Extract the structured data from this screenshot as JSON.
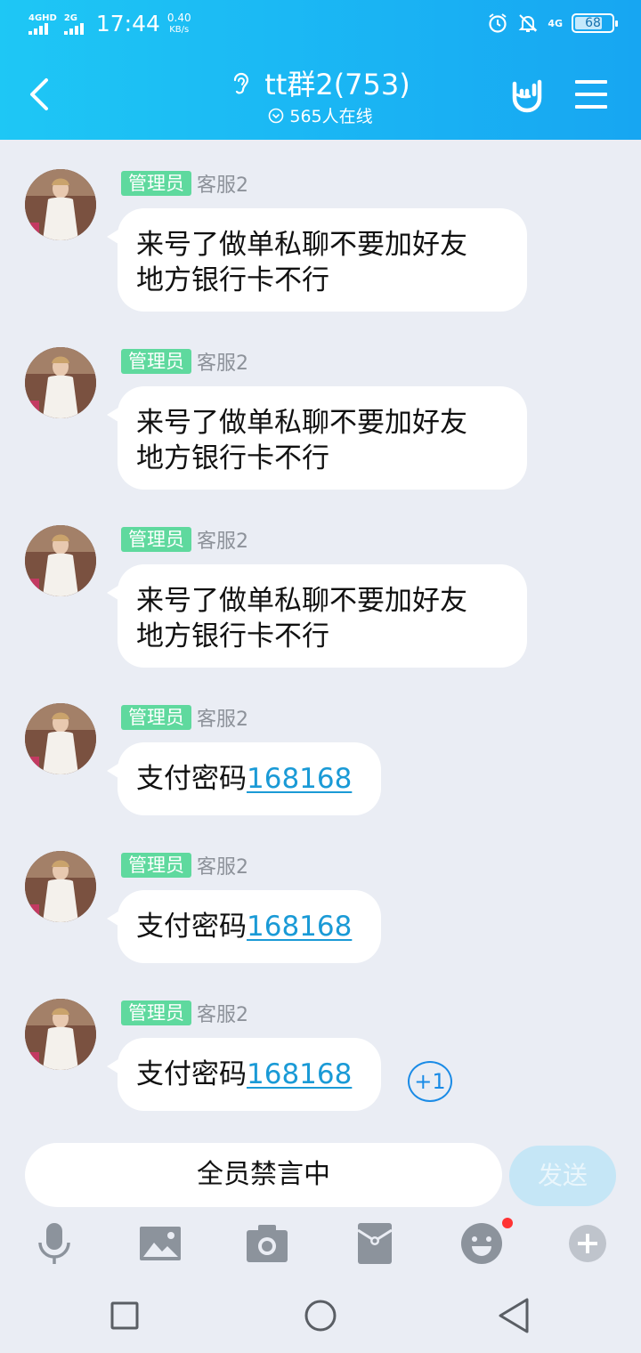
{
  "status_bar": {
    "sim1": "4GHD",
    "sim2": "2G",
    "time": "17:44",
    "speed_value": "0.40",
    "speed_unit": "KB/s",
    "net_small": "4G",
    "battery": "68"
  },
  "header": {
    "title": "tt群2(753)",
    "online": "565人在线"
  },
  "messages": [
    {
      "badge": "管理员",
      "sender": "客服2",
      "line1": "来号了做单私聊不要加好友",
      "line2": "地方银行卡不行"
    },
    {
      "badge": "管理员",
      "sender": "客服2",
      "line1": "来号了做单私聊不要加好友",
      "line2": "地方银行卡不行"
    },
    {
      "badge": "管理员",
      "sender": "客服2",
      "line1": "来号了做单私聊不要加好友",
      "line2": "地方银行卡不行"
    },
    {
      "badge": "管理员",
      "sender": "客服2",
      "text": "支付密码",
      "number": "168168"
    },
    {
      "badge": "管理员",
      "sender": "客服2",
      "text": "支付密码",
      "number": "168168"
    },
    {
      "badge": "管理员",
      "sender": "客服2",
      "text": "支付密码",
      "number": "168168"
    }
  ],
  "plus_one": "+1",
  "input": {
    "muted_text": "全员禁言中",
    "send_label": "发送"
  },
  "colors": {
    "header_start": "#1ec7f5",
    "header_end": "#17a6f2",
    "admin_badge": "#5fd99e",
    "link": "#1a9ad6",
    "background": "#eaedf4"
  },
  "icons": [
    "back-icon",
    "ear-icon",
    "rock-hand-icon",
    "menu-icon",
    "microphone-icon",
    "image-icon",
    "camera-icon",
    "red-packet-icon",
    "emoji-icon",
    "plus-icon",
    "recent-apps-icon",
    "home-icon",
    "back-nav-icon"
  ]
}
